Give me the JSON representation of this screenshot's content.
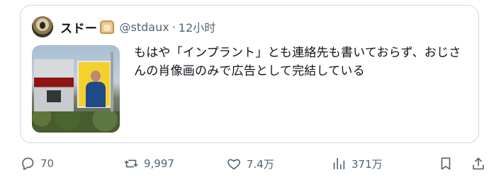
{
  "quote": {
    "display_name": "スドー",
    "display_name_emoji": "bread-icon",
    "handle": "@stdaux",
    "separator": "·",
    "timestamp": "12小时",
    "text": "もはや「インプラント」とも連絡先も書いておらず、おじさんの肖像画のみで広告として完結している",
    "media": {
      "description_icon": "image-thumbnail"
    }
  },
  "actions": {
    "reply": {
      "icon": "reply-icon",
      "count": "70"
    },
    "repost": {
      "icon": "repost-icon",
      "count": "9,997"
    },
    "like": {
      "icon": "heart-icon",
      "count": "7.4万"
    },
    "views": {
      "icon": "analytics-icon",
      "count": "371万"
    },
    "bookmark": {
      "icon": "bookmark-icon"
    },
    "share": {
      "icon": "share-icon"
    }
  },
  "colors": {
    "border": "#cfd9de",
    "text_primary": "#0f1419",
    "text_secondary": "#536471"
  }
}
